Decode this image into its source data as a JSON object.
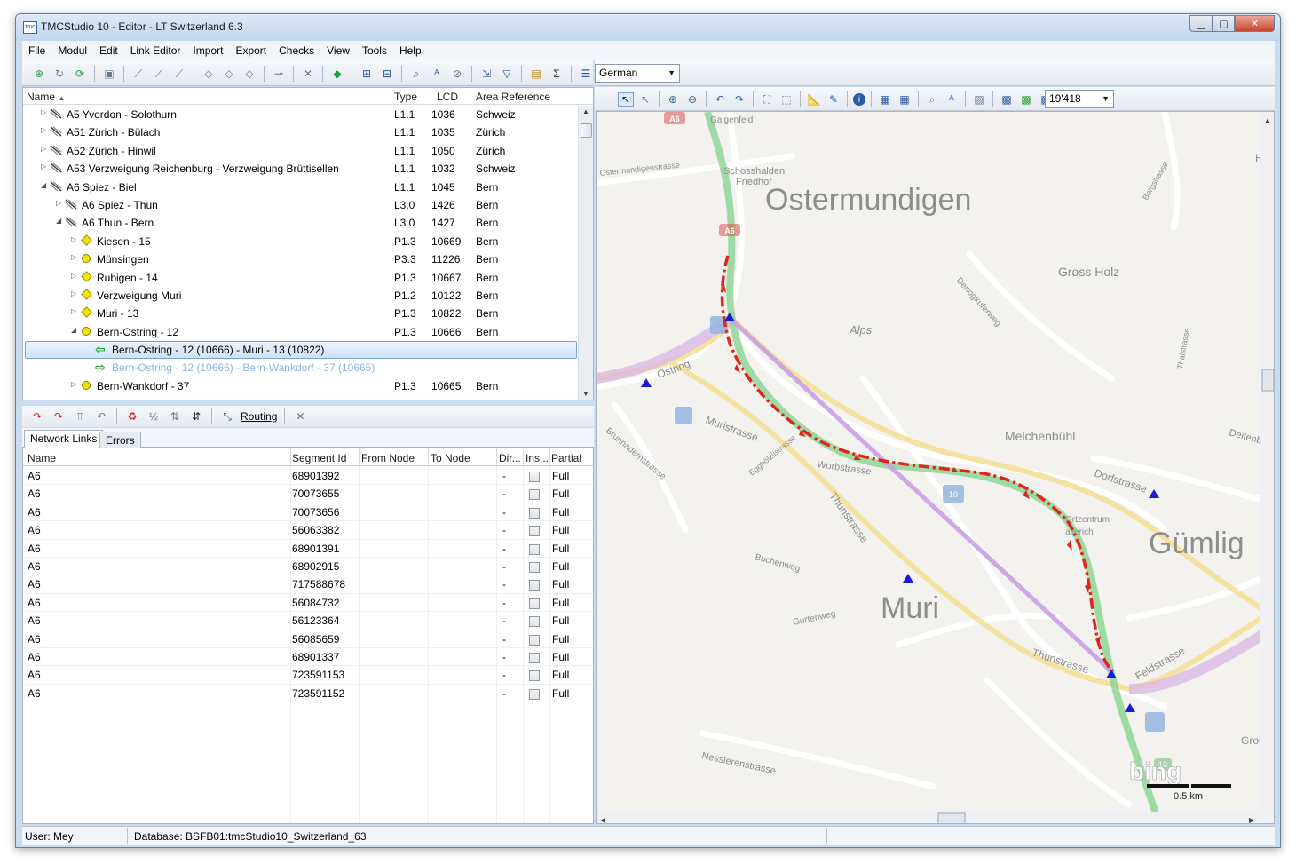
{
  "window": {
    "title": "TMCStudio 10 - Editor - LT Switzerland 6.3",
    "app_icon_text": "tmc"
  },
  "menu": [
    "File",
    "Modul",
    "Edit",
    "Link Editor",
    "Import",
    "Export",
    "Checks",
    "View",
    "Tools",
    "Help"
  ],
  "language_select": {
    "value": "German"
  },
  "zoom_select": {
    "value": "19'418"
  },
  "tree": {
    "columns": [
      "Name",
      "Type",
      "LCD",
      "Area Reference"
    ],
    "rows": [
      {
        "indent": 1,
        "expander": "▷",
        "icon": "road",
        "name": "A5 Yverdon - Solothurn",
        "type": "L1.1",
        "lcd": "1036",
        "area": "Schweiz"
      },
      {
        "indent": 1,
        "expander": "▷",
        "icon": "road",
        "name": "A51 Zürich - Bülach",
        "type": "L1.1",
        "lcd": "1035",
        "area": "Zürich"
      },
      {
        "indent": 1,
        "expander": "▷",
        "icon": "road",
        "name": "A52 Zürich - Hinwil",
        "type": "L1.1",
        "lcd": "1050",
        "area": "Zürich"
      },
      {
        "indent": 1,
        "expander": "▷",
        "icon": "road",
        "name": "A53 Verzweigung Reichenburg - Verzweigung Brüttisellen",
        "type": "L1.1",
        "lcd": "1032",
        "area": "Schweiz"
      },
      {
        "indent": 1,
        "expander": "◢",
        "icon": "road",
        "name": "A6 Spiez - Biel",
        "type": "L1.1",
        "lcd": "1045",
        "area": "Bern"
      },
      {
        "indent": 2,
        "expander": "▷",
        "icon": "road",
        "name": "A6 Spiez - Thun",
        "type": "L3.0",
        "lcd": "1426",
        "area": "Bern"
      },
      {
        "indent": 2,
        "expander": "◢",
        "icon": "road",
        "name": "A6 Thun - Bern",
        "type": "L3.0",
        "lcd": "1427",
        "area": "Bern"
      },
      {
        "indent": 3,
        "expander": "▷",
        "icon": "junction",
        "name": "Kiesen - 15",
        "type": "P1.3",
        "lcd": "10669",
        "area": "Bern"
      },
      {
        "indent": 3,
        "expander": "▷",
        "icon": "point",
        "name": "Münsingen",
        "type": "P3.3",
        "lcd": "11226",
        "area": "Bern"
      },
      {
        "indent": 3,
        "expander": "▷",
        "icon": "junction",
        "name": "Rubigen - 14",
        "type": "P1.3",
        "lcd": "10667",
        "area": "Bern"
      },
      {
        "indent": 3,
        "expander": "▷",
        "icon": "junction",
        "name": "Verzweigung Muri",
        "type": "P1.2",
        "lcd": "10122",
        "area": "Bern"
      },
      {
        "indent": 3,
        "expander": "▷",
        "icon": "junction",
        "name": "Muri - 13",
        "type": "P1.3",
        "lcd": "10822",
        "area": "Bern"
      },
      {
        "indent": 3,
        "expander": "◢",
        "icon": "point",
        "name": "Bern-Ostring - 12",
        "type": "P1.3",
        "lcd": "10666",
        "area": "Bern"
      },
      {
        "indent": 4,
        "expander": "",
        "icon": "arrow-back",
        "name": "Bern-Ostring - 12 (10666) - Muri - 13 (10822)",
        "type": "",
        "lcd": "",
        "area": "",
        "selected": true
      },
      {
        "indent": 4,
        "expander": "",
        "icon": "arrow-forward",
        "name": "Bern-Ostring - 12 (10666) - Bern-Wankdorf - 37 (10665)",
        "type": "",
        "lcd": "",
        "area": "",
        "muted": true
      },
      {
        "indent": 3,
        "expander": "▷",
        "icon": "point",
        "name": "Bern-Wankdorf - 37",
        "type": "P1.3",
        "lcd": "10665",
        "area": "Bern"
      }
    ]
  },
  "toolbar2": {
    "routing_label": "Routing"
  },
  "tabs": [
    "Network Links",
    "Errors"
  ],
  "grid": {
    "columns": [
      "Name",
      "Segment Id",
      "From Node",
      "To Node",
      "Dir...",
      "Ins...",
      "Partial"
    ],
    "rows": [
      {
        "name": "A6",
        "segment": "68901392",
        "from": "",
        "to": "",
        "dir": "-",
        "partial": "Full"
      },
      {
        "name": "A6",
        "segment": "70073655",
        "from": "",
        "to": "",
        "dir": "-",
        "partial": "Full"
      },
      {
        "name": "A6",
        "segment": "70073656",
        "from": "",
        "to": "",
        "dir": "-",
        "partial": "Full"
      },
      {
        "name": "A6",
        "segment": "56063382",
        "from": "",
        "to": "",
        "dir": "-",
        "partial": "Full"
      },
      {
        "name": "A6",
        "segment": "68901391",
        "from": "",
        "to": "",
        "dir": "-",
        "partial": "Full"
      },
      {
        "name": "A6",
        "segment": "68902915",
        "from": "",
        "to": "",
        "dir": "-",
        "partial": "Full"
      },
      {
        "name": "A6",
        "segment": "717588678",
        "from": "",
        "to": "",
        "dir": "-",
        "partial": "Full"
      },
      {
        "name": "A6",
        "segment": "56084732",
        "from": "",
        "to": "",
        "dir": "-",
        "partial": "Full"
      },
      {
        "name": "A6",
        "segment": "56123364",
        "from": "",
        "to": "",
        "dir": "-",
        "partial": "Full"
      },
      {
        "name": "A6",
        "segment": "56085659",
        "from": "",
        "to": "",
        "dir": "-",
        "partial": "Full"
      },
      {
        "name": "A6",
        "segment": "68901337",
        "from": "",
        "to": "",
        "dir": "-",
        "partial": "Full"
      },
      {
        "name": "A6",
        "segment": "723591153",
        "from": "",
        "to": "",
        "dir": "-",
        "partial": "Full"
      },
      {
        "name": "A6",
        "segment": "723591152",
        "from": "",
        "to": "",
        "dir": "-",
        "partial": "Full"
      }
    ]
  },
  "map": {
    "labels": {
      "ostermundigen": "Ostermundigen",
      "gross_holz": "Gross Holz",
      "alps": "Alps",
      "melchenbuehl": "Melchenbühl",
      "muri": "Muri",
      "guemlig": "Gümlig",
      "galgenfeld": "Galgenfeld",
      "schosshalden": "Schosshalden",
      "friedhof": "Friedhof",
      "muristrasse": "Muristrasse",
      "thunstrasse": "Thunstrasse",
      "thunstrasse2": "Thunstrasse",
      "worbstrasse": "Worbstrasse",
      "dorfstrasse": "Dorfstrasse",
      "feldstrasse": "Feldstrasse",
      "nesslerenstrasse": "Nesslerenstrasse",
      "gurtenweg": "Gurtenweg",
      "buchenweg": "Buchenweg",
      "bergstrasse": "Bergstrasse",
      "denogkuferweg": "Denogkuferweg",
      "thalstrasse": "Thalstrasse",
      "deitenb": "Deitenb",
      "ostring": "Ostring",
      "egghalden": "Egghölzlistrasse",
      "brunnaderen": "Brunnadernstrasse",
      "ostermundigenstrasse": "Ostermundigenstrasse",
      "ortzentrum": "Ortzentrum",
      "allerich": "allerich",
      "gross": "Gros",
      "hase": "Has",
      "a6_shield": "A6",
      "a6_shield2": "A6",
      "exit_10": "10",
      "exit_13": "13",
      "bing_logo": "bing",
      "scale": "0.5 km"
    },
    "colors": {
      "route": "#e0251b",
      "straight_link": "#c9a0e6",
      "node": "#1a1ad9",
      "motorway": "#88d491"
    }
  },
  "status": {
    "user": "User: Mey",
    "database": "Database: BSFB01:tmcStudio10_Switzerland_63"
  }
}
